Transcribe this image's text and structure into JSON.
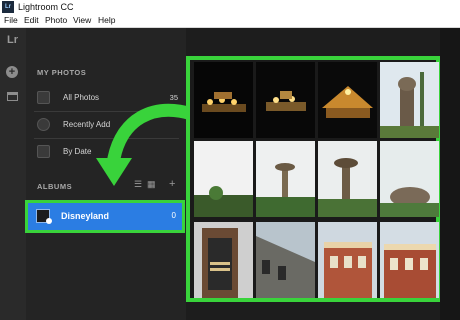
{
  "window": {
    "title": "Lightroom CC",
    "app_icon": "Lr"
  },
  "menu": [
    "File",
    "Edit",
    "Photo",
    "View",
    "Help"
  ],
  "toolstrip": {
    "logo": "Lr"
  },
  "my_photos": {
    "title": "MY PHOTOS",
    "items": [
      {
        "label": "All Photos",
        "count": "35",
        "icon": "photo-icon"
      },
      {
        "label": "Recently Add",
        "count": "",
        "icon": "clock-icon"
      },
      {
        "label": "By Date",
        "count": "",
        "icon": "calendar-icon"
      }
    ]
  },
  "albums": {
    "title": "ALBUMS",
    "items": [
      {
        "label": "Disneyland",
        "count": "0"
      }
    ]
  },
  "colors": {
    "highlight": "#39d33b",
    "selected": "#2b7de3",
    "panel": "#242424"
  }
}
